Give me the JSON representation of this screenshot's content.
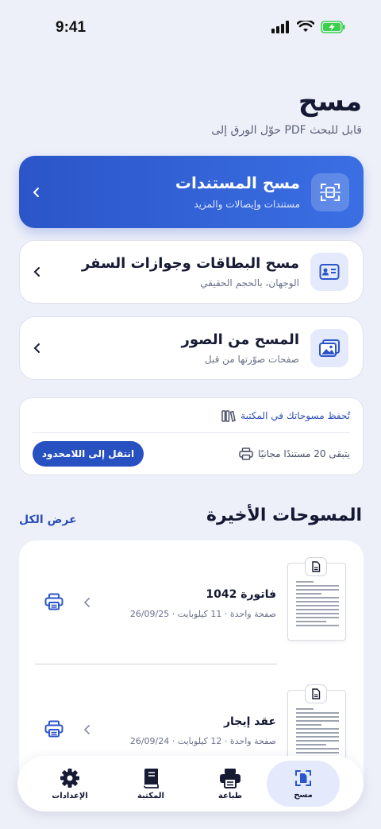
{
  "status": {
    "time": "9:41"
  },
  "header": {
    "title": "مسح",
    "subtitle": "حوّل الورق إلى PDF قابل للبحث"
  },
  "scan_options": [
    {
      "title": "مسح المستندات",
      "subtitle": "مستندات وإيصالات والمزيد",
      "icon": "scan-document-icon"
    },
    {
      "title": "مسح البطاقات وجوازات السفر",
      "subtitle": "الوجهان، بالحجم الحقيقي",
      "icon": "id-card-icon"
    },
    {
      "title": "المسح من الصور",
      "subtitle": "صفحات صوّرتها من قبل",
      "icon": "photos-icon"
    }
  ],
  "info": {
    "library_note": "تُحفظ مسوحاتك في المكتبة",
    "remaining": "يتبقى 20 مستندًا مجانيًا",
    "upgrade_label": "انتقل إلى اللامحدود"
  },
  "recent": {
    "title": "المسوحات الأخيرة",
    "view_all": "عرض الكل",
    "items": [
      {
        "name": "فاتورة 1042",
        "meta": "26/09/25 · صفحة واحدة · 11 كيلوبايت"
      },
      {
        "name": "عقد إيجار",
        "meta": "26/09/24 · صفحة واحدة · 12 كيلوبايت"
      }
    ]
  },
  "tabs": [
    {
      "label": "مسح",
      "icon": "scan-icon",
      "active": true
    },
    {
      "label": "طباعة",
      "icon": "printer-icon"
    },
    {
      "label": "المكتبة",
      "icon": "book-icon"
    },
    {
      "label": "الإعدادات",
      "icon": "gear-icon"
    }
  ],
  "colors": {
    "accent": "#2b55c9",
    "background": "#eef0f9",
    "text": "#161a33",
    "battery": "#3ccf4e"
  }
}
